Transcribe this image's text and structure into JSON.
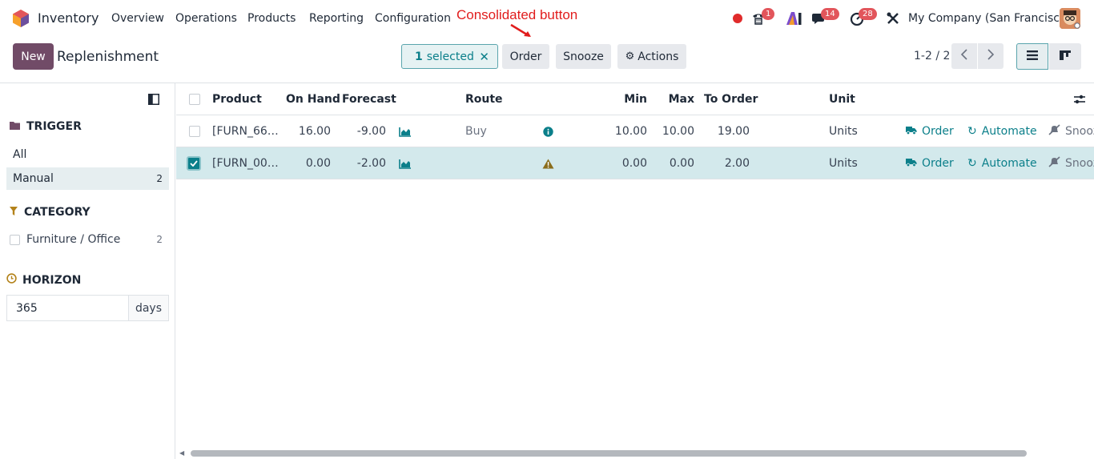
{
  "navbar": {
    "app_name": "Inventory",
    "menu": [
      "Overview",
      "Operations",
      "Products",
      "Reporting",
      "Configuration"
    ],
    "annotation": "Consolidated button",
    "badges": {
      "activity": "1",
      "messages": "14",
      "timers": "28"
    },
    "company": "My Company (San Francisco)"
  },
  "control_panel": {
    "new_label": "New",
    "breadcrumb": "Replenishment",
    "selected_count": "1",
    "selected_text": "selected",
    "order_label": "Order",
    "snooze_label": "Snooze",
    "actions_label": "Actions",
    "pager": "1-2 / 2"
  },
  "sidebar": {
    "trigger_title": "TRIGGER",
    "trigger_items": [
      {
        "label": "All",
        "count": ""
      },
      {
        "label": "Manual",
        "count": "2"
      }
    ],
    "category_title": "CATEGORY",
    "category_items": [
      {
        "label": "Furniture / Office",
        "count": "2"
      }
    ],
    "horizon_title": "HORIZON",
    "horizon_value": "365",
    "horizon_unit": "days"
  },
  "table": {
    "columns": [
      "Product",
      "On Hand",
      "Forecast",
      "Route",
      "Min",
      "Max",
      "To Order",
      "Unit"
    ],
    "rows": [
      {
        "product": "[FURN_66…",
        "on_hand": "16.00",
        "forecast": "-9.00",
        "route": "Buy",
        "min": "10.00",
        "max": "10.00",
        "to_order": "19.00",
        "unit": "Units",
        "selected": false
      },
      {
        "product": "[FURN_00…",
        "on_hand": "0.00",
        "forecast": "-2.00",
        "route": "",
        "min": "0.00",
        "max": "0.00",
        "to_order": "2.00",
        "unit": "Units",
        "selected": true
      }
    ],
    "row_actions": {
      "order": "Order",
      "automate": "Automate",
      "snooze": "Snooz"
    }
  },
  "colors": {
    "brand": "#714b67",
    "accent": "#0b7f8a",
    "annotation": "#e11d1d",
    "badge": "#e2555b"
  }
}
